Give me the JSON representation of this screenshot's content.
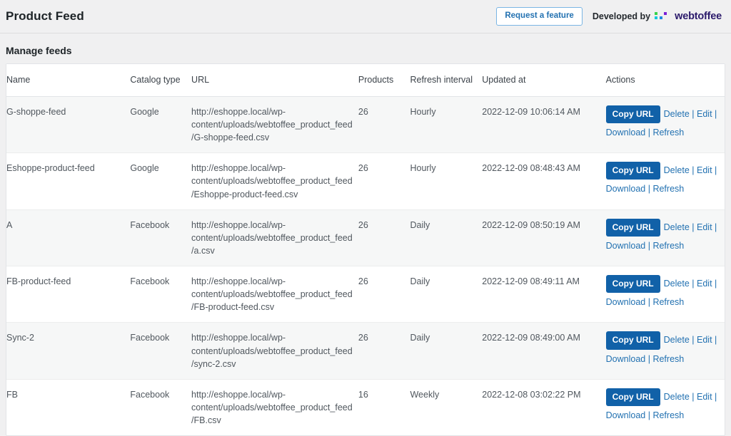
{
  "header": {
    "title": "Product Feed",
    "request_feature_label": "Request a feature",
    "developed_by_label": "Developed by",
    "brand_name": "webtoffee",
    "brand_colors": {
      "square_green": "#3ad24b",
      "square_cyan": "#14c8dc",
      "square_blue": "#1e8ae0",
      "square_purple": "#7b1fd6",
      "wordmark": "#2b1a6b",
      "request_feature_text": "#2271b1",
      "request_feature_border": "#7ab5e4"
    }
  },
  "section": {
    "title": "Manage feeds"
  },
  "table": {
    "columns": [
      "Name",
      "Catalog type",
      "URL",
      "Products",
      "Refresh interval",
      "Updated at",
      "Actions"
    ],
    "accent_button_color": "#1161a8",
    "link_color": "#2271b1",
    "actions": {
      "copy_url_label": "Copy URL",
      "delete_label": "Delete",
      "edit_label": "Edit",
      "download_label": "Download",
      "refresh_label": "Refresh",
      "separator": "|"
    },
    "rows": [
      {
        "name": "G-shoppe-feed",
        "catalog_type": "Google",
        "url": "http://eshoppe.local/wp-content/uploads/webtoffee_product_feed/G-shoppe-feed.csv",
        "products": "26",
        "refresh_interval": "Hourly",
        "updated_at": "2022-12-09 10:06:14 AM"
      },
      {
        "name": "Eshoppe-product-feed",
        "catalog_type": "Google",
        "url": "http://eshoppe.local/wp-content/uploads/webtoffee_product_feed/Eshoppe-product-feed.csv",
        "products": "26",
        "refresh_interval": "Hourly",
        "updated_at": "2022-12-09 08:48:43 AM"
      },
      {
        "name": "A",
        "catalog_type": "Facebook",
        "url": "http://eshoppe.local/wp-content/uploads/webtoffee_product_feed/a.csv",
        "products": "26",
        "refresh_interval": "Daily",
        "updated_at": "2022-12-09 08:50:19 AM"
      },
      {
        "name": "FB-product-feed",
        "catalog_type": "Facebook",
        "url": "http://eshoppe.local/wp-content/uploads/webtoffee_product_feed/FB-product-feed.csv",
        "products": "26",
        "refresh_interval": "Daily",
        "updated_at": "2022-12-09 08:49:11 AM"
      },
      {
        "name": "Sync-2",
        "catalog_type": "Facebook",
        "url": "http://eshoppe.local/wp-content/uploads/webtoffee_product_feed/sync-2.csv",
        "products": "26",
        "refresh_interval": "Daily",
        "updated_at": "2022-12-09 08:49:00 AM"
      },
      {
        "name": "FB",
        "catalog_type": "Facebook",
        "url": "http://eshoppe.local/wp-content/uploads/webtoffee_product_feed/FB.csv",
        "products": "16",
        "refresh_interval": "Weekly",
        "updated_at": "2022-12-08 03:02:22 PM"
      }
    ]
  }
}
